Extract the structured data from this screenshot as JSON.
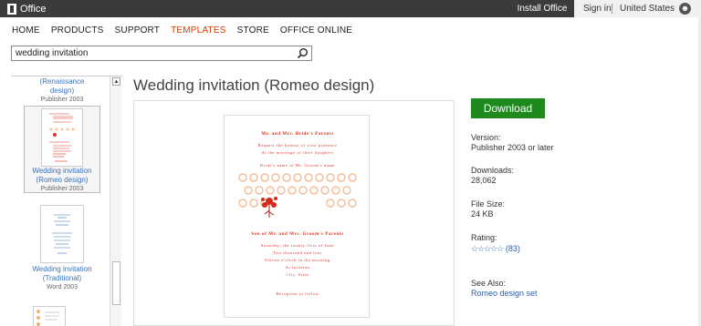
{
  "topbar": {
    "brand": "Office",
    "install_label": "Install Office",
    "signin_label": "Sign in",
    "country_label": "United States"
  },
  "nav": {
    "items": [
      {
        "label": "HOME",
        "active": false
      },
      {
        "label": "PRODUCTS",
        "active": false
      },
      {
        "label": "SUPPORT",
        "active": false
      },
      {
        "label": "TEMPLATES",
        "active": true
      },
      {
        "label": "STORE",
        "active": false
      },
      {
        "label": "OFFICE ONLINE",
        "active": false
      }
    ],
    "active_color": "#d83b01"
  },
  "search": {
    "value": "wedding invitation",
    "icon": "search-icon"
  },
  "thumbnails": [
    {
      "title_lines": [
        "(Renaissance",
        "design)"
      ],
      "subtitle": "Publisher 2003"
    },
    {
      "title_lines": [
        "Wedding invitation",
        "(Romeo design)"
      ],
      "subtitle": "Publisher 2003"
    },
    {
      "title_lines": [
        "Wedding invitation",
        "(Traditional)"
      ],
      "subtitle": "Word 2003"
    }
  ],
  "main": {
    "title": "Wedding invitation (Romeo design)",
    "invitation": {
      "line1": "Mr. and Mrs. Bride's Parents",
      "line2": "Request the honour of your presence",
      "line3": "At the marriage of their daughter",
      "line4": "Bride's name to Mr. Groom's name",
      "line5": "Son of Mr. and Mrs. Groom's Parents",
      "line6": "Saturday, the twenty-first of June",
      "line7": "Two thousand and four",
      "line8": "Eleven o'clock in the morning",
      "line9": "At location",
      "line10": "City, State",
      "line11": "Reception to follow"
    }
  },
  "details": {
    "download_label": "Download",
    "download_color": "#1e8a1e",
    "version_label": "Version:",
    "version_value": "Publisher 2003 or later",
    "downloads_label": "Downloads:",
    "downloads_value": "28,062",
    "filesize_label": "File Size:",
    "filesize_value": "24 KB",
    "rating_label": "Rating:",
    "rating_stars": "☆☆☆☆☆",
    "rating_count": "(83)",
    "see_also_label": "See Also:",
    "see_also_link": "Romeo design set"
  }
}
